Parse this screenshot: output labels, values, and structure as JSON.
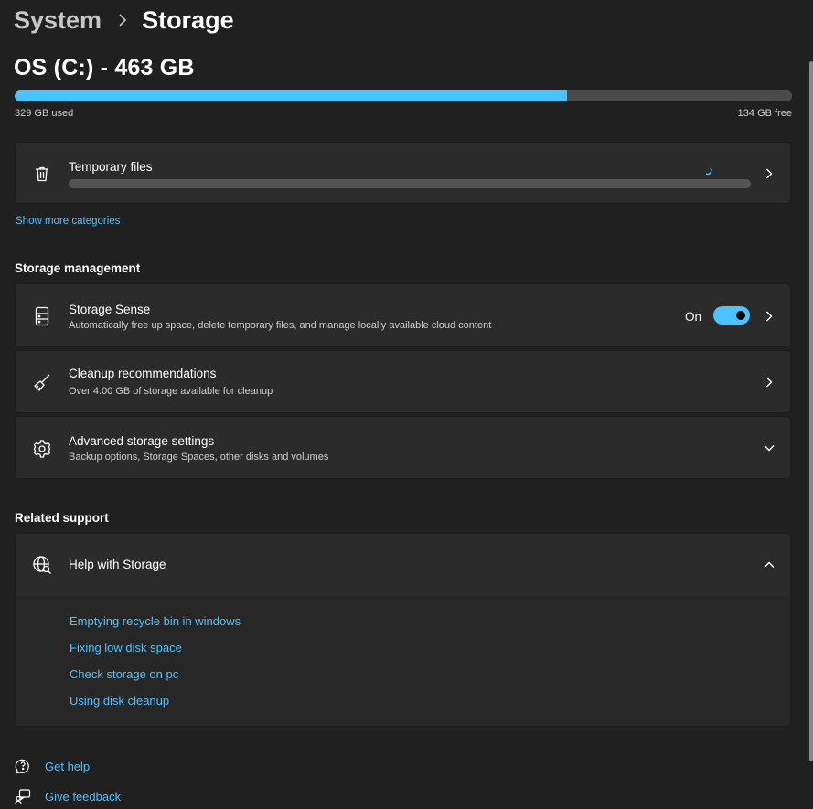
{
  "breadcrumb": {
    "parent": "System",
    "current": "Storage"
  },
  "drive": {
    "title": "OS (C:) - 463 GB",
    "used_label": "329 GB used",
    "free_label": "134 GB free",
    "used_fraction": 0.711
  },
  "temporary_files": {
    "title": "Temporary files"
  },
  "show_more": "Show more categories",
  "storage_management": {
    "heading": "Storage management",
    "storage_sense": {
      "title": "Storage Sense",
      "subtitle": "Automatically free up space, delete temporary files, and manage locally available cloud content",
      "toggle_label": "On",
      "toggle_on": true
    },
    "cleanup": {
      "title": "Cleanup recommendations",
      "subtitle": "Over 4.00 GB of storage available for cleanup"
    },
    "advanced": {
      "title": "Advanced storage settings",
      "subtitle": "Backup options, Storage Spaces, other disks and volumes"
    }
  },
  "related_support": {
    "heading": "Related support",
    "help": {
      "title": "Help with Storage",
      "links": [
        "Emptying recycle bin in windows",
        "Fixing low disk space",
        "Check storage on pc",
        "Using disk cleanup"
      ]
    }
  },
  "footer": {
    "get_help": "Get help",
    "give_feedback": "Give feedback"
  },
  "colors": {
    "accent": "#4cc2ff",
    "background": "#202020",
    "card": "#2b2b2b"
  },
  "icons": [
    "chevron-right-icon",
    "trash-icon",
    "spinner-icon",
    "drive-icon",
    "broom-icon",
    "gear-icon",
    "chevron-down-icon",
    "globe-search-icon",
    "chevron-up-icon",
    "help-icon",
    "feedback-icon"
  ]
}
